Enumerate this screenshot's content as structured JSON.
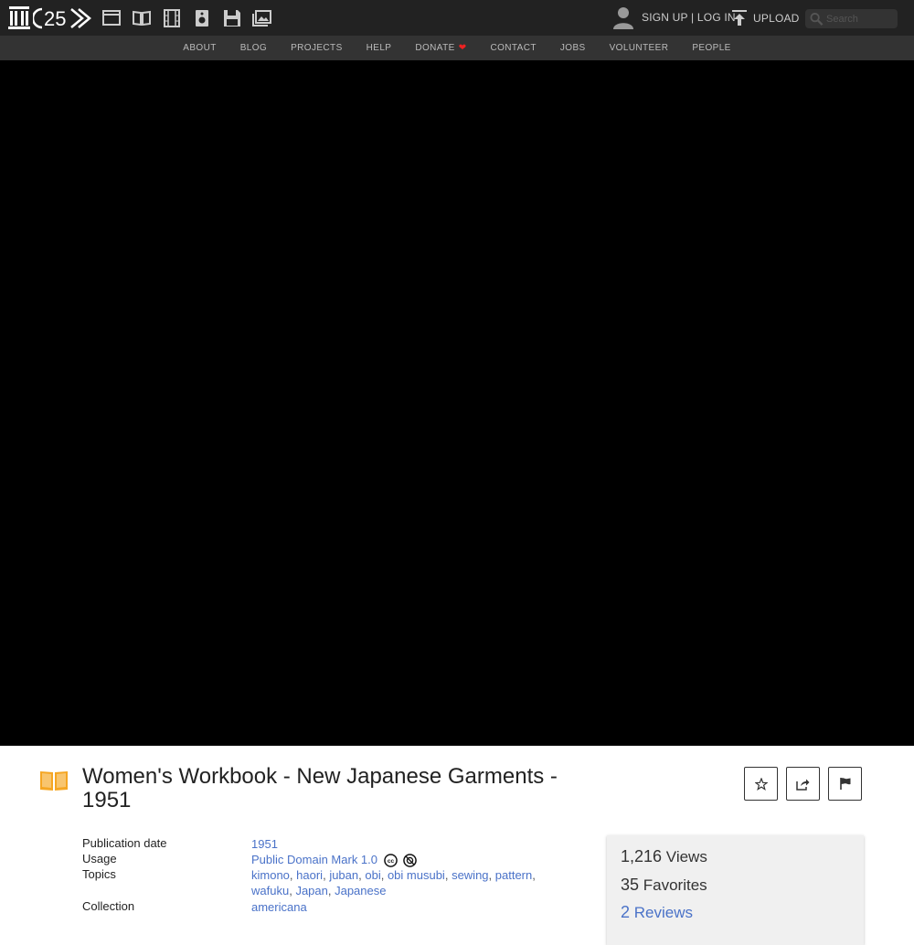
{
  "header": {
    "logo_icon": "archive-temple-icon",
    "logo_text": "25",
    "media_icons": [
      "web-icon",
      "texts-icon",
      "video-icon",
      "audio-icon",
      "software-icon",
      "images-icon"
    ],
    "signin_label": "SIGN UP | LOG IN",
    "upload_label": "UPLOAD",
    "search_placeholder": "Search"
  },
  "nav": {
    "items": [
      "ABOUT",
      "BLOG",
      "PROJECTS",
      "HELP",
      "DONATE",
      "CONTACT",
      "JOBS",
      "VOLUNTEER",
      "PEOPLE"
    ],
    "donate_heart": "❤"
  },
  "item": {
    "icon": "book-icon",
    "title": "Women's Workbook - New Japanese Garments - 1951",
    "actions": [
      "favorite-icon",
      "share-icon",
      "flag-icon"
    ]
  },
  "metadata": {
    "publication_label": "Publication date",
    "publication_value": "1951",
    "usage_label": "Usage",
    "usage_value": "Public Domain Mark 1.0",
    "topics_label": "Topics",
    "topics": [
      "kimono",
      "haori",
      "juban",
      "obi",
      "obi musubi",
      "sewing",
      "pattern",
      "wafuku",
      "Japan",
      "Japanese"
    ],
    "collection_label": "Collection",
    "collection_value": "americana"
  },
  "stats": {
    "views_count": "1,216",
    "views_label": "Views",
    "favorites_count": "35",
    "favorites_label": "Favorites",
    "reviews_count": "2",
    "reviews_label": "Reviews"
  },
  "colors": {
    "topbar": "#222222",
    "navbar": "#333333",
    "link": "#4a72c8",
    "icon_orange": "#f5a623",
    "heart": "#ee2222"
  }
}
